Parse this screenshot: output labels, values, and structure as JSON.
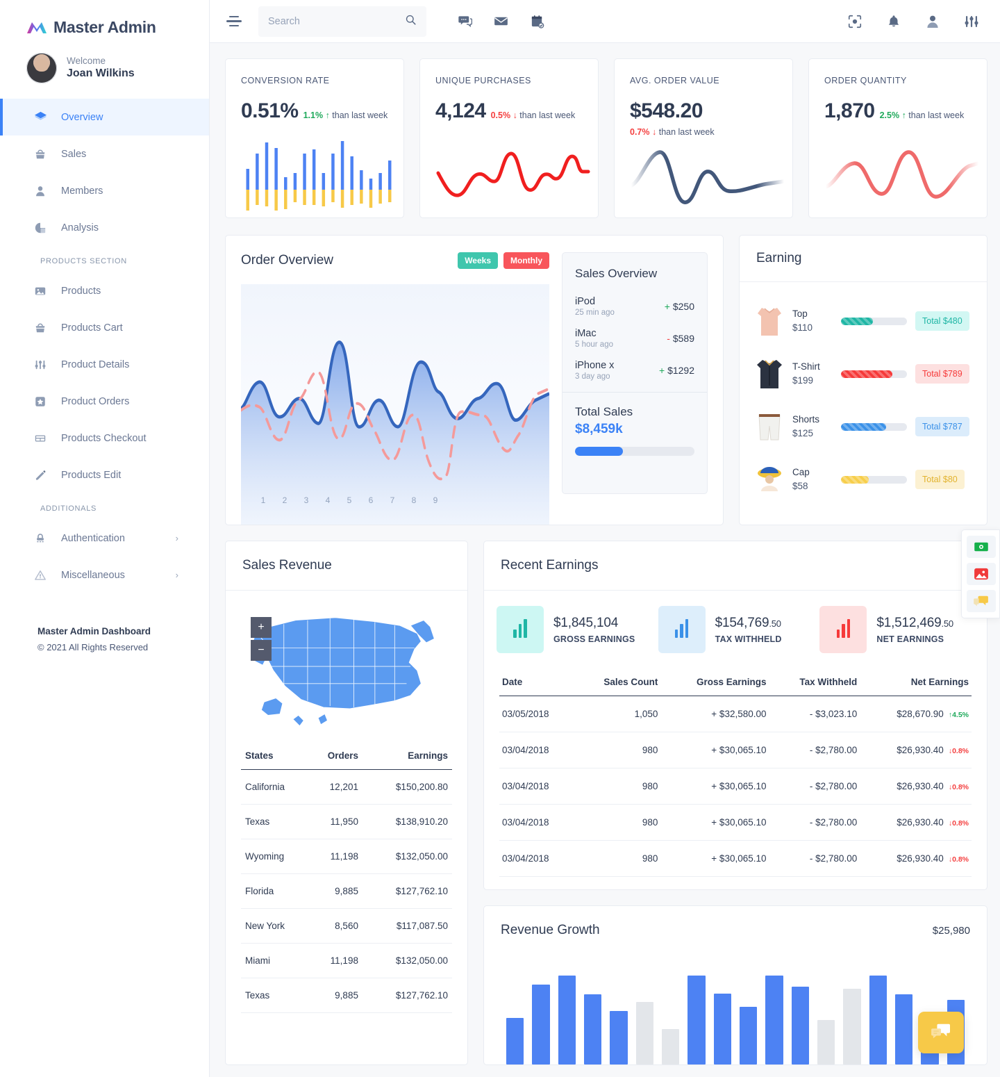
{
  "brand": {
    "name": "Master Admin",
    "logo_icon": "gradient-m-logo"
  },
  "sidebar": {
    "welcome_label": "Welcome",
    "user_name": "Joan Wilkins",
    "primary_items": [
      {
        "label": "Overview",
        "icon": "layers-icon",
        "active": true
      },
      {
        "label": "Sales",
        "icon": "basket-icon",
        "active": false
      },
      {
        "label": "Members",
        "icon": "user-icon",
        "active": false
      },
      {
        "label": "Analysis",
        "icon": "pie-chart-icon",
        "active": false
      }
    ],
    "products_section_label": "PRODUCTS SECTION",
    "product_items": [
      {
        "label": "Products",
        "icon": "image-icon"
      },
      {
        "label": "Products Cart",
        "icon": "basket-icon"
      },
      {
        "label": "Product Details",
        "icon": "sliders-icon"
      },
      {
        "label": "Product Orders",
        "icon": "star-icon"
      },
      {
        "label": "Products Checkout",
        "icon": "table-icon"
      },
      {
        "label": "Products Edit",
        "icon": "pencil-icon"
      }
    ],
    "additionals_section_label": "ADDITIONALS",
    "additional_items": [
      {
        "label": "Authentication",
        "icon": "lock-icon",
        "chevron": "›"
      },
      {
        "label": "Miscellaneous",
        "icon": "warning-icon",
        "chevron": "›"
      }
    ],
    "footer_title": "Master Admin Dashboard",
    "footer_copyright": "© 2021 All Rights Reserved"
  },
  "topbar": {
    "menu_icon": "hamburger-icon",
    "search_placeholder": "Search",
    "search_value": "",
    "left_icons": [
      "chat-icon",
      "envelope-icon",
      "calendar-check-icon"
    ],
    "right_icons": [
      "scan-icon",
      "bell-icon",
      "user-icon",
      "sliders-icon"
    ]
  },
  "kpis": [
    {
      "title": "CONVERSION RATE",
      "value": "0.51%",
      "delta": "1.1%",
      "direction": "up",
      "arrow": "↑",
      "suffix": "than last week",
      "chart": "stacked-bars"
    },
    {
      "title": "UNIQUE PURCHASES",
      "value": "4,124",
      "delta": "0.5%",
      "direction": "down",
      "arrow": "↓",
      "suffix": "than last week",
      "chart": "red-line"
    },
    {
      "title": "AVG. ORDER VALUE",
      "value": "$548.20",
      "delta": "0.7%",
      "direction": "down",
      "arrow": "↓",
      "suffix": "than last week",
      "chart": "navy-wave"
    },
    {
      "title": "ORDER QUANTITY",
      "value": "1,870",
      "delta": "2.5%",
      "direction": "up",
      "arrow": "↑",
      "suffix": "than last week",
      "chart": "pink-wave"
    }
  ],
  "order_overview": {
    "title": "Order Overview",
    "toggle_weeks": "Weeks",
    "toggle_monthly": "Monthly",
    "x_labels": [
      "1",
      "2",
      "3",
      "4",
      "5",
      "6",
      "7",
      "8",
      "9"
    ]
  },
  "sales_overview": {
    "title": "Sales Overview",
    "items": [
      {
        "name": "iPod",
        "time": "25 min ago",
        "sign": "+",
        "amount": "$250",
        "positive": true
      },
      {
        "name": "iMac",
        "time": "5 hour ago",
        "sign": "-",
        "amount": "$589",
        "positive": false
      },
      {
        "name": "iPhone x",
        "time": "3 day ago",
        "sign": "+",
        "amount": "$1292",
        "positive": true
      }
    ],
    "total_label": "Total Sales",
    "total_value": "$8,459k",
    "progress_percent": 40
  },
  "earning": {
    "title": "Earning",
    "items": [
      {
        "name": "Top",
        "price": "$110",
        "badge": "Total $480",
        "color": "#1fb6a5",
        "badge_bg": "#d2f7f3",
        "percent": 48,
        "thumb": "top-thumb"
      },
      {
        "name": "T-Shirt",
        "price": "$199",
        "badge": "Total $789",
        "color": "#f63a3a",
        "badge_bg": "#fde0e0",
        "percent": 78,
        "thumb": "tshirt-thumb"
      },
      {
        "name": "Shorts",
        "price": "$125",
        "badge": "Total $787",
        "color": "#3b91e8",
        "badge_bg": "#dbecfb",
        "percent": 68,
        "thumb": "shorts-thumb"
      },
      {
        "name": "Cap",
        "price": "$58",
        "badge": "Total $80",
        "color": "#f7ce4b",
        "badge_bg": "#fcf1d2",
        "percent": 42,
        "thumb": "cap-thumb"
      }
    ]
  },
  "sales_revenue": {
    "title": "Sales Revenue",
    "zoom_in": "+",
    "zoom_out": "−",
    "map_region": "united-states",
    "columns": [
      "States",
      "Orders",
      "Earnings"
    ],
    "rows": [
      {
        "state": "California",
        "orders": "12,201",
        "earnings": "$150,200.80"
      },
      {
        "state": "Texas",
        "orders": "11,950",
        "earnings": "$138,910.20"
      },
      {
        "state": "Wyoming",
        "orders": "11,198",
        "earnings": "$132,050.00"
      },
      {
        "state": "Florida",
        "orders": "9,885",
        "earnings": "$127,762.10"
      },
      {
        "state": "New York",
        "orders": "8,560",
        "earnings": "$117,087.50"
      },
      {
        "state": "Miami",
        "orders": "11,198",
        "earnings": "$132,050.00"
      },
      {
        "state": "Texas",
        "orders": "9,885",
        "earnings": "$127,762.10"
      }
    ]
  },
  "recent_earnings": {
    "title": "Recent Earnings",
    "summary": [
      {
        "value": "$1,845,104",
        "decimals": "",
        "label": "GROSS EARNINGS",
        "color": "#1fb6a5",
        "bg": "#cdf7f3"
      },
      {
        "value": "$154,769",
        "decimals": ".50",
        "label": "TAX WITHHELD",
        "color": "#3b91e8",
        "bg": "#ddeefb"
      },
      {
        "value": "$1,512,469",
        "decimals": ".50",
        "label": "NET EARNINGS",
        "color": "#f63a3a",
        "bg": "#fde0e0"
      }
    ],
    "columns": [
      "Date",
      "Sales Count",
      "Gross Earnings",
      "Tax Withheld",
      "Net Earnings"
    ],
    "rows": [
      {
        "date": "03/05/2018",
        "count": "1,050",
        "gross": "+ $32,580.00",
        "tax": "- $3,023.10",
        "net": "$28,670.90",
        "trend": "4.5%",
        "trend_dir": "up",
        "arrow": "↑"
      },
      {
        "date": "03/04/2018",
        "count": "980",
        "gross": "+ $30,065.10",
        "tax": "- $2,780.00",
        "net": "$26,930.40",
        "trend": "0.8%",
        "trend_dir": "down",
        "arrow": "↓"
      },
      {
        "date": "03/04/2018",
        "count": "980",
        "gross": "+ $30,065.10",
        "tax": "- $2,780.00",
        "net": "$26,930.40",
        "trend": "0.8%",
        "trend_dir": "down",
        "arrow": "↓"
      },
      {
        "date": "03/04/2018",
        "count": "980",
        "gross": "+ $30,065.10",
        "tax": "- $2,780.00",
        "net": "$26,930.40",
        "trend": "0.8%",
        "trend_dir": "down",
        "arrow": "↓"
      },
      {
        "date": "03/04/2018",
        "count": "980",
        "gross": "+ $30,065.10",
        "tax": "- $2,780.00",
        "net": "$26,930.40",
        "trend": "0.8%",
        "trend_dir": "down",
        "arrow": "↓"
      }
    ]
  },
  "revenue_growth": {
    "title": "Revenue Growth",
    "value": "$25,980"
  },
  "chart_data": [
    {
      "type": "bar",
      "name": "revenue-growth",
      "title": "Revenue Growth",
      "values": [
        42,
        72,
        80,
        63,
        48,
        56,
        32,
        80,
        64,
        52,
        80,
        70,
        40,
        68,
        80,
        63,
        45,
        58
      ],
      "colors": [
        "#4d82f3",
        "#4d82f3",
        "#4d82f3",
        "#4d82f3",
        "#4d82f3",
        "#e3e6ea",
        "#e3e6ea",
        "#4d82f3",
        "#4d82f3",
        "#4d82f3",
        "#4d82f3",
        "#4d82f3",
        "#e3e6ea",
        "#e3e6ea",
        "#4d82f3",
        "#4d82f3",
        "#4d82f3",
        "#4d82f3"
      ],
      "ylim": [
        0,
        100
      ],
      "grid": false,
      "xlabel": "",
      "ylabel": ""
    },
    {
      "type": "area",
      "name": "order-overview",
      "title": "Order Overview",
      "x": [
        "1",
        "2",
        "3",
        "4",
        "5",
        "6",
        "7",
        "8",
        "9"
      ],
      "series": [
        {
          "name": "Weeks",
          "style": "solid-blue",
          "values": [
            38,
            52,
            28,
            48,
            24,
            88,
            22,
            50,
            26,
            70,
            58,
            30,
            52,
            26,
            46
          ]
        },
        {
          "name": "Monthly",
          "style": "dashed-red",
          "values": [
            42,
            30,
            18,
            50,
            22,
            46,
            58,
            72,
            24,
            34,
            48,
            30,
            10,
            40,
            28,
            44
          ]
        }
      ],
      "ylim": [
        0,
        100
      ],
      "grid": false
    },
    {
      "type": "bar",
      "name": "conversion-rate-sparkline",
      "title": "CONVERSION RATE",
      "values": [
        30,
        52,
        72,
        64,
        22,
        28,
        55,
        62,
        30,
        58,
        76,
        50,
        34,
        22,
        30,
        44
      ],
      "negatives": [
        34,
        24,
        30,
        46,
        36,
        22,
        28,
        28,
        30,
        22,
        34,
        30,
        26,
        34,
        24,
        22
      ],
      "colors": [
        "#4d82f3",
        "#f7c948"
      ],
      "ylim": [
        0,
        100
      ],
      "grid": false
    },
    {
      "type": "line",
      "name": "unique-purchases-sparkline",
      "title": "UNIQUE PURCHASES",
      "values": [
        46,
        28,
        22,
        40,
        44,
        38,
        66,
        60,
        24,
        18,
        36,
        30,
        56,
        62,
        40,
        42
      ],
      "color": "#f01f1f",
      "grid": false
    },
    {
      "type": "line",
      "name": "avg-order-value-sparkline",
      "title": "AVG. ORDER VALUE",
      "values": [
        20,
        48,
        72,
        62,
        22,
        10,
        30,
        52,
        48,
        30,
        26,
        24
      ],
      "color": "#42577a",
      "grid": false
    },
    {
      "type": "line",
      "name": "order-quantity-sparkline",
      "title": "ORDER QUANTITY",
      "values": [
        30,
        52,
        60,
        42,
        26,
        50,
        74,
        66,
        30,
        20,
        44,
        62
      ],
      "color": "#ef6a6a",
      "grid": false
    }
  ],
  "float_widgets": [
    {
      "icon": "money-icon",
      "color": "#16b04b"
    },
    {
      "icon": "image-icon",
      "color": "#f03a3a"
    },
    {
      "icon": "chat-icon",
      "color": "#f7c948"
    }
  ],
  "fab": {
    "icon": "chat-bubbles-icon",
    "color": "#f7c948"
  }
}
